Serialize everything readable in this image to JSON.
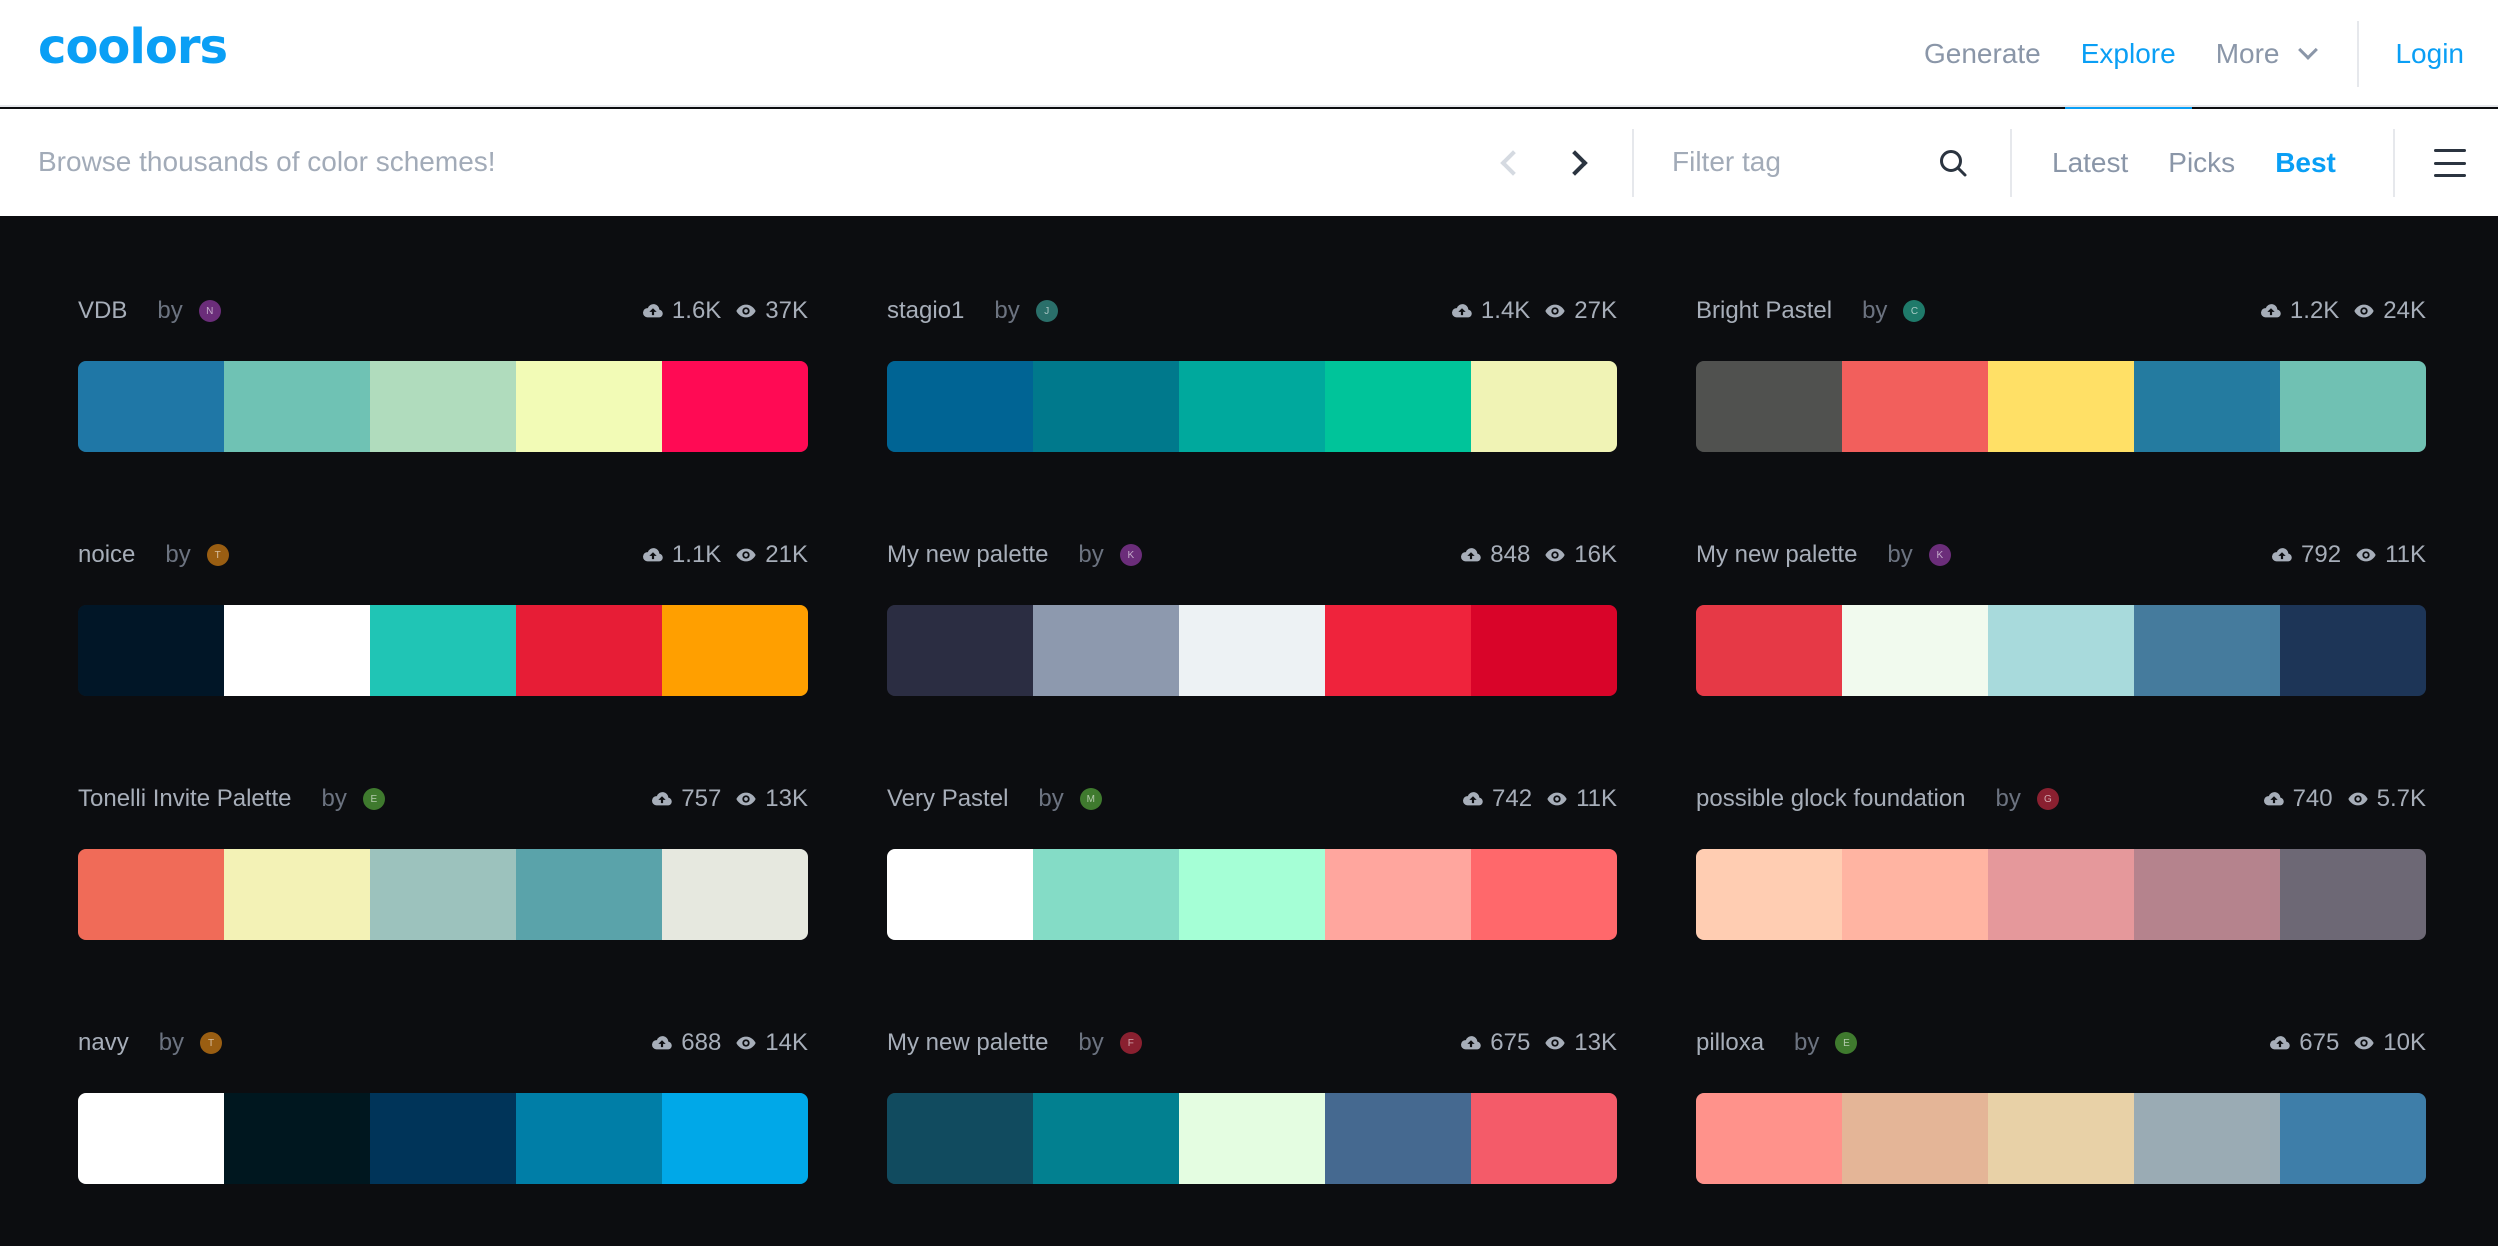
{
  "navbar": {
    "logo": "coolors",
    "links": [
      {
        "label": "Generate",
        "active": false
      },
      {
        "label": "Explore",
        "active": true
      },
      {
        "label": "More",
        "active": false
      }
    ],
    "login": "Login"
  },
  "subbar": {
    "search_placeholder": "Browse thousands of color schemes!",
    "filter_placeholder": "Filter tag",
    "sort_tabs": [
      {
        "label": "Latest",
        "active": false
      },
      {
        "label": "Picks",
        "active": false
      },
      {
        "label": "Best",
        "active": true
      }
    ]
  },
  "icons": {
    "prev": "chevron-left-icon",
    "next": "chevron-right-icon",
    "search": "search-icon",
    "menu": "hamburger-menu-icon",
    "saves": "cloud-upload-icon",
    "views": "eye-icon"
  },
  "by_label": "by",
  "palettes": [
    {
      "name": "VDB",
      "avatar": "N",
      "avatar_color": "#6b2d7a",
      "saves": "1.6K",
      "views": "37K",
      "colors": [
        "#1f77a6",
        "#6fc2b4",
        "#b0dcbd",
        "#f2fbb6",
        "#ff0a54"
      ]
    },
    {
      "name": "stagio1",
      "avatar": "J",
      "avatar_color": "#2a6f6a",
      "saves": "1.4K",
      "views": "27K",
      "colors": [
        "#006494",
        "#00798c",
        "#00a99d",
        "#00c49a",
        "#f0f3b5"
      ]
    },
    {
      "name": "Bright Pastel",
      "avatar": "C",
      "avatar_color": "#1f7a6a",
      "saves": "1.2K",
      "views": "24K",
      "colors": [
        "#50514f",
        "#f25f5c",
        "#ffe066",
        "#247ba0",
        "#70c1b3"
      ]
    },
    {
      "name": "noice",
      "avatar": "T",
      "avatar_color": "#9a5e12",
      "saves": "1.1K",
      "views": "21K",
      "colors": [
        "#011627",
        "#ffffff",
        "#20c5b5",
        "#e71d36",
        "#ff9f00"
      ]
    },
    {
      "name": "My new palette",
      "avatar": "K",
      "avatar_color": "#6b2d7a",
      "saves": "848",
      "views": "16K",
      "colors": [
        "#2b2d42",
        "#8d99ae",
        "#edf2f4",
        "#ef233c",
        "#d90429"
      ]
    },
    {
      "name": "My new palette",
      "avatar": "K",
      "avatar_color": "#6b2d7a",
      "saves": "792",
      "views": "11K",
      "colors": [
        "#e63946",
        "#f1faee",
        "#a8dadc",
        "#457b9d",
        "#1d3557"
      ]
    },
    {
      "name": "Tonelli Invite Palette",
      "avatar": "E",
      "avatar_color": "#3f7a2e",
      "saves": "757",
      "views": "13K",
      "colors": [
        "#f06b58",
        "#f3f2b6",
        "#9cc2bd",
        "#5aa3aa",
        "#e6e8df"
      ]
    },
    {
      "name": "Very Pastel",
      "avatar": "M",
      "avatar_color": "#3f7a2e",
      "saves": "742",
      "views": "11K",
      "colors": [
        "#ffffff",
        "#84dcc6",
        "#a5ffd6",
        "#ffa69e",
        "#ff686b"
      ]
    },
    {
      "name": "possible glock foundation",
      "avatar": "G",
      "avatar_color": "#8a2030",
      "saves": "740",
      "views": "5.7K",
      "colors": [
        "#ffcdb2",
        "#ffb4a2",
        "#e5989b",
        "#b5838d",
        "#6d6875"
      ]
    },
    {
      "name": "navy",
      "avatar": "T",
      "avatar_color": "#9a5e12",
      "saves": "688",
      "views": "14K",
      "colors": [
        "#ffffff",
        "#00171f",
        "#003459",
        "#007ea7",
        "#00a8e8"
      ]
    },
    {
      "name": "My new palette",
      "avatar": "F",
      "avatar_color": "#8a2030",
      "saves": "675",
      "views": "13K",
      "colors": [
        "#114b5f",
        "#028090",
        "#e4fde1",
        "#456990",
        "#f45b69"
      ]
    },
    {
      "name": "pilloxa",
      "avatar": "E",
      "avatar_color": "#3f7a2e",
      "saves": "675",
      "views": "10K",
      "colors": [
        "#ff928b",
        "#e4b597",
        "#e8d1a7",
        "#9aabb4",
        "#3e7ea9"
      ]
    }
  ]
}
